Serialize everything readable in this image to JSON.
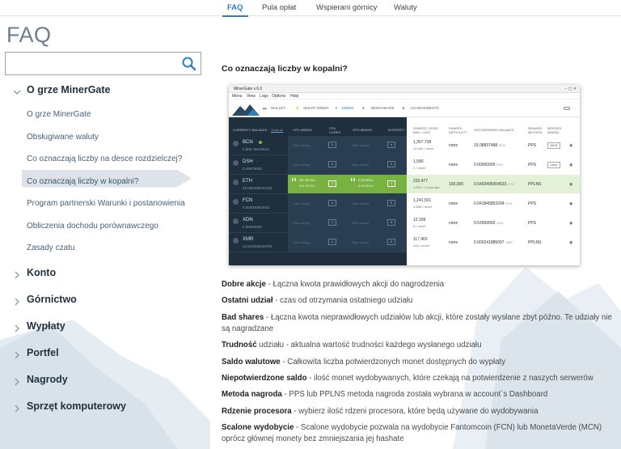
{
  "tabs": [
    {
      "label": "FAQ",
      "active": true
    },
    {
      "label": "Pula opłat",
      "active": false
    },
    {
      "label": "Wspierani górnicy",
      "active": false
    },
    {
      "label": "Waluty",
      "active": false
    }
  ],
  "page_title": "FAQ",
  "search": {
    "value": "",
    "placeholder": ""
  },
  "sidebar": {
    "sections": [
      {
        "label": "O grze MinerGate",
        "expanded": true
      },
      {
        "label": "Konto",
        "expanded": false
      },
      {
        "label": "Górnictwo",
        "expanded": false
      },
      {
        "label": "Wypłaty",
        "expanded": false
      },
      {
        "label": "Portfel",
        "expanded": false
      },
      {
        "label": "Nagrody",
        "expanded": false
      },
      {
        "label": "Sprzęt komputerowy",
        "expanded": false
      }
    ],
    "items": [
      {
        "label": "O grze MinerGate"
      },
      {
        "label": "Obsługiwane waluty"
      },
      {
        "label": "Co oznaczają liczby na desce rozdzielczej?"
      },
      {
        "label": "Co oznaczają liczby w kopalni?",
        "active": true
      },
      {
        "label": "Program partnerski Warunki i postanowienia"
      },
      {
        "label": "Obliczenia dochodu porównawczego"
      },
      {
        "label": "Zasady czatu"
      }
    ]
  },
  "question": "Co oznaczają liczby w kopalni?",
  "screenshot": {
    "title": "MinerGate v.6.0",
    "menu": [
      "Menu",
      "View",
      "Logs",
      "Options",
      "Help"
    ],
    "toolbar": [
      "WALLET",
      "SMART MINER",
      "MINER",
      "BENCHMARK",
      "ACHIEVEMENTS"
    ],
    "headers": {
      "currency": "CURRENCY BALANCE",
      "show_all": "Show all",
      "cpu": "CPU MINING",
      "cpu_cores": "CPU CORES",
      "gpu": "GPU MINING",
      "intensity": "INTENSITY",
      "shares": "SHARES: GOOD BAD / LAST",
      "difficulty": "SHARES DIFFICULTY",
      "unconfirmed": "UNCONFIRMED BALANCE",
      "reward": "REWARD METHOD",
      "merged": "MERGED MINING"
    },
    "start_label": "Start mining",
    "rows": [
      {
        "sym": "BCN",
        "bal": "4,506.76819615",
        "cpu_cores": "1",
        "intensity": "4",
        "shares": "1,357,738",
        "shares2": "10,484 / never",
        "diff": "none",
        "unconf": "15.08837488",
        "unconf_unit": "BCN",
        "method": "PPS",
        "merged": "MCN",
        "mining": false
      },
      {
        "sym": "DSH",
        "bal": "0.29678693",
        "cpu_cores": "1",
        "intensity": "2",
        "shares": "1,580",
        "shares2": "2 / never",
        "diff": "none",
        "unconf": "0.00000000",
        "unconf_unit": "DSH",
        "method": "PPS",
        "merged": "none",
        "mining": false
      },
      {
        "sym": "ETH",
        "bal": "45.065490010156",
        "cpu_rate": "457.52 H/s",
        "cpu_rate2": "431.20 H/s",
        "gpu_rate": "2.93 MH/s",
        "gpu_rate2": "5.56 MH/s",
        "cpu_cores": "1",
        "intensity": "2",
        "shares": "232,477",
        "shares2": "1,093 / 0 secs ago",
        "diff": "100,000",
        "unconf": "0.5403495004023",
        "unconf_unit": "ETH",
        "method": "PPLNS",
        "merged": "",
        "mining": true
      },
      {
        "sym": "FCN",
        "bal": "0.000000000001",
        "cpu_cores": "1",
        "intensity": "2",
        "shares": "1,241,501",
        "shares2": "4,688 / never",
        "diff": "none",
        "unconf": "0.041845853204",
        "unconf_unit": "FCN",
        "method": "PPS",
        "merged": "",
        "mining": false
      },
      {
        "sym": "XDN",
        "bal": "0.00000000",
        "cpu_cores": "1",
        "intensity": "2",
        "shares": "12,199",
        "shares2": "4 / never",
        "diff": "none",
        "unconf": "0.53569560",
        "unconf_unit": "XDN",
        "method": "PPS",
        "merged": "",
        "mining": false
      },
      {
        "sym": "XMR",
        "bal": "14.542356345760",
        "cpu_cores": "1",
        "intensity": "2",
        "shares": "117,463",
        "shares2": "418 / never",
        "diff": "none",
        "unconf": "0.000241885097",
        "unconf_unit": "XMR",
        "method": "PPLNS",
        "merged": "",
        "mining": false
      }
    ]
  },
  "definitions": [
    {
      "term": "Dobre akcje",
      "text": " - Łączna kwota prawidłowych akcji do nagrodzenia"
    },
    {
      "term": "Ostatni udział",
      "text": " - czas od otrzymania ostatniego udziału"
    },
    {
      "term": "Bad shares",
      "text": " - Łączna kwota nieprawidłowych udziałów lub akcji, które zostały wysłane zbyt późno. Te udziały nie są nagradzane"
    },
    {
      "term": "Trudność",
      "text": " udziału - aktualna wartość trudności każdego wysłanego udziału"
    },
    {
      "term": "Saldo walutowe",
      "text": " - Całkowita liczba potwierdzonych monet dostępnych do wypłaty"
    },
    {
      "term": "Niepotwierdzone saldo",
      "text": " - ilość monet wydobywanych, które czekają na potwierdzenie z naszych serwerów"
    },
    {
      "term": "Metoda nagroda",
      "text": " - PPS lub PPLNS metoda nagroda została wybrana w account`s Dashboard"
    },
    {
      "term": "Rdzenie procesora",
      "text": " - wybierz ilość rdzeni procesora, które będą używane do wydobywania"
    },
    {
      "term": "Scalone wydobycie",
      "text": " - Scalone wydobycie pozwala na wydobycie Fantomcoin (FCN) lub MonetaVerde (MCN) oprócz głównej monety bez zmniejszania jej hashate"
    }
  ],
  "colors": {
    "accent": "#2d7fc1",
    "mining_green": "#78b342",
    "dark_panel": "#1f2f3e"
  }
}
